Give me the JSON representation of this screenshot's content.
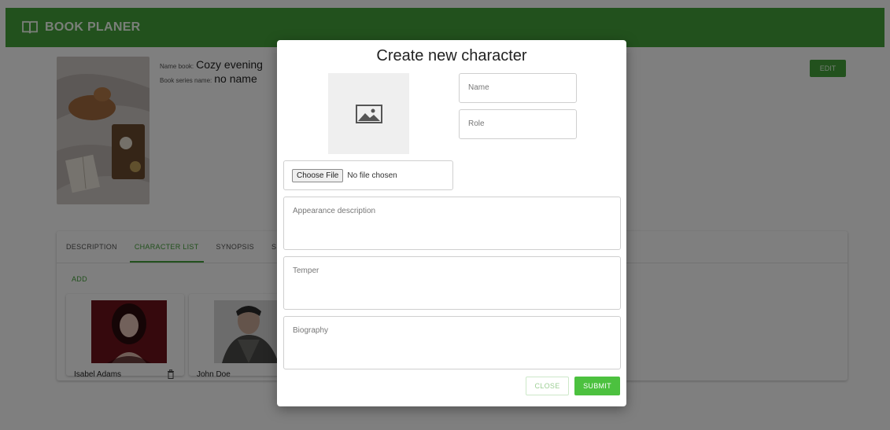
{
  "app": {
    "title": "BOOK PLANER",
    "logo_icon": "book-open-icon"
  },
  "book": {
    "name_label": "Name book:",
    "name_value": "Cozy evening",
    "series_label": "Book series name:",
    "series_value": "no name",
    "edit_label": "EDIT"
  },
  "tabs": [
    {
      "label": "DESCRIPTION"
    },
    {
      "label": "CHARACTER LIST"
    },
    {
      "label": "SYNOPSIS"
    },
    {
      "label": "S"
    }
  ],
  "characters": {
    "add_label": "ADD",
    "items": [
      {
        "name": "Isabel Adams"
      },
      {
        "name": "John Doe"
      }
    ]
  },
  "modal": {
    "title": "Create new character",
    "image_placeholder_icon": "image-icon",
    "name_placeholder": "Name",
    "role_placeholder": "Role",
    "choose_file_label": "Choose File",
    "file_status": "No file chosen",
    "appearance_placeholder": "Appearance description",
    "temper_placeholder": "Temper",
    "biography_placeholder": "Biography",
    "close_label": "CLOSE",
    "submit_label": "SUBMIT"
  },
  "colors": {
    "brand_green": "#45a23a",
    "submit_green": "#4cc13f",
    "overlay": "rgba(0,0,0,0.5)"
  }
}
